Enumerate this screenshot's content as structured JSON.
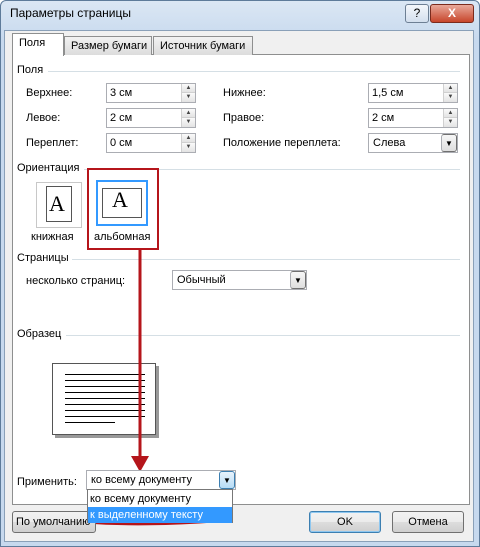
{
  "window": {
    "title": "Параметры страницы",
    "help_label": "?",
    "close_label": "X"
  },
  "tabs": [
    {
      "label": "Поля",
      "active": true
    },
    {
      "label": "Размер бумаги",
      "active": false
    },
    {
      "label": "Источник бумаги",
      "active": false
    }
  ],
  "margins": {
    "group_label": "Поля",
    "top_label": "Верхнее:",
    "top_value": "3 см",
    "bottom_label": "Нижнее:",
    "bottom_value": "1,5 см",
    "left_label": "Левое:",
    "left_value": "2 см",
    "right_label": "Правое:",
    "right_value": "2 см",
    "gutter_label": "Переплет:",
    "gutter_value": "0 см",
    "gutter_pos_label": "Положение переплета:",
    "gutter_pos_value": "Слева"
  },
  "orientation": {
    "group_label": "Ориентация",
    "portrait_label": "книжная",
    "landscape_label": "альбомная",
    "glyph": "A",
    "selected": "landscape",
    "highlight_color": "#b5151b"
  },
  "pages": {
    "group_label": "Страницы",
    "multiple_label": "несколько страниц:",
    "multiple_value": "Обычный"
  },
  "sample": {
    "group_label": "Образец"
  },
  "apply": {
    "label": "Применить:",
    "value": "ко всему документу",
    "options": [
      "ко всему документу",
      "к выделенному тексту"
    ],
    "highlighted_index": 1
  },
  "footer": {
    "default_label": "По умолчанию",
    "ok_label": "OK",
    "cancel_label": "Отмена"
  },
  "colors": {
    "annotation": "#b5151b",
    "selection": "#3399ff"
  }
}
